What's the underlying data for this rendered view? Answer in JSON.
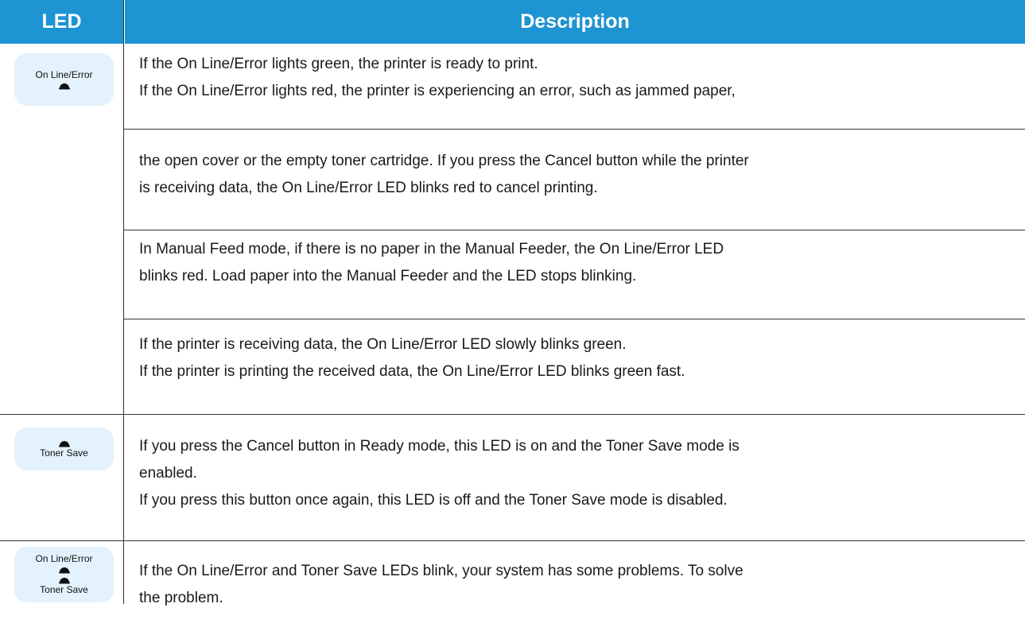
{
  "header": {
    "led": "LED",
    "description": "Description"
  },
  "rows": [
    {
      "lines": [
        "If the On Line/Error lights green, the printer is ready to print.",
        "If the On Line/Error lights red, the printer is experiencing an error, such as jammed paper,"
      ]
    },
    {
      "lines": [
        "the open cover or the empty toner cartridge. If you press the Cancel button while the printer",
        "is receiving data, the On Line/Error LED blinks red to cancel printing."
      ]
    },
    {
      "lines": [
        "In Manual Feed mode, if there is no paper in the Manual Feeder, the On Line/Error LED",
        "blinks red. Load paper into the Manual Feeder and the LED stops blinking."
      ]
    },
    {
      "lines": [
        "If the printer is receiving data, the On Line/Error LED slowly blinks green.",
        "If the printer is printing the received data, the On Line/Error LED blinks green fast."
      ]
    },
    {
      "lines": [
        "If you press the Cancel button in Ready mode, this LED is on and the Toner Save mode is",
        "enabled.",
        "If you press this button once again, this LED is off and the Toner Save mode is disabled."
      ]
    },
    {
      "lines": [
        "If the On Line/Error and Toner Save LEDs blink, your system has some problems. To solve",
        "the problem."
      ]
    }
  ],
  "badges": {
    "online_error": "On Line/Error",
    "toner_save": "Toner Save"
  },
  "icons": {
    "led": "led-dome-icon"
  },
  "colors": {
    "header_bg": "#1e94d2",
    "badge_bg": "#e3f2fc"
  }
}
